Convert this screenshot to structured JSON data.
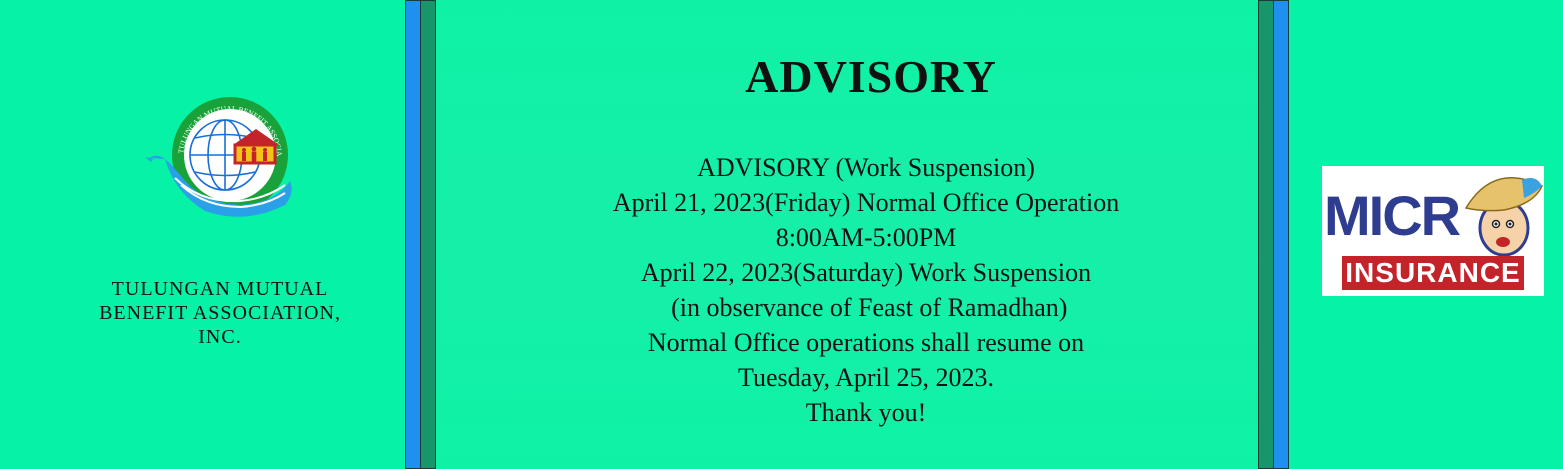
{
  "left": {
    "org_name_lines": [
      "TULUNGAN MUTUAL",
      "BENEFIT ASSOCIATION,",
      "INC."
    ],
    "logo": {
      "icon": "tmba-logo",
      "ring_text": "TULUNGAN MUTUAL BENEFIT ASSOCIATION, INC."
    }
  },
  "center": {
    "title": "ADVISORY",
    "lines": [
      "ADVISORY (Work Suspension)",
      "April 21, 2023(Friday) Normal Office Operation",
      "8:00AM-5:00PM",
      "April 22, 2023(Saturday) Work Suspension",
      " (in observance of Feast of Ramadhan)",
      "Normal Office operations shall resume on",
      "Tuesday, April 25, 2023.",
      "Thank you!"
    ]
  },
  "right": {
    "micro_label": "MICR",
    "insurance_label": "INSURANCE",
    "logo": {
      "icon": "micro-insurance-logo"
    }
  },
  "colors": {
    "background": "#0af0a4",
    "bar_blue": "#1f8ff0",
    "bar_green": "#16966a",
    "micro_blue": "#2e3d8f",
    "insurance_red": "#c4232a"
  }
}
